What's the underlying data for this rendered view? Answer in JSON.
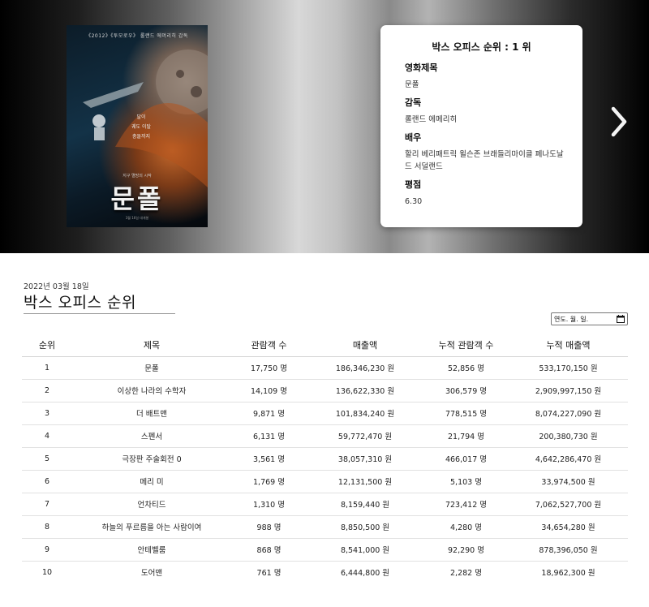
{
  "hero": {
    "poster": {
      "top_text": "《2012》《투모로우》 롤랜드 에머리히 감독",
      "tagline": [
        "달이",
        "궤도 이탈",
        "충돌까지"
      ],
      "subtitle": "지구 멸망의 시작",
      "title": "문폴",
      "credits": "3월 16일 대개봉"
    },
    "card": {
      "title": "박스 오피스 순위 : 1 위",
      "movie_title_label": "영화제목",
      "movie_title": "문폴",
      "director_label": "감독",
      "director": "롤랜드 에메리히",
      "actors_label": "배우",
      "actors": "할리 베리패트릭 윌슨존 브래들리마이클 페나도날드 서덜랜드",
      "rating_label": "평점",
      "rating": "6.30"
    },
    "next_icon": "chevron-right-icon"
  },
  "main": {
    "date": "2022년 03월 18일",
    "title": "박스 오피스 순위",
    "date_input": {
      "placeholder": "연도. 월. 일.",
      "icon": "calendar-icon"
    }
  },
  "table": {
    "headers": [
      "순위",
      "제목",
      "관람객 수",
      "매출액",
      "누적 관람객 수",
      "누적 매출액"
    ],
    "rows": [
      [
        "1",
        "문폴",
        "17,750 명",
        "186,346,230 원",
        "52,856 명",
        "533,170,150 원"
      ],
      [
        "2",
        "이상한 나라의 수학자",
        "14,109 명",
        "136,622,330 원",
        "306,579 명",
        "2,909,997,150 원"
      ],
      [
        "3",
        "더 배트맨",
        "9,871 명",
        "101,834,240 원",
        "778,515 명",
        "8,074,227,090 원"
      ],
      [
        "4",
        "스펜서",
        "6,131 명",
        "59,772,470 원",
        "21,794 명",
        "200,380,730 원"
      ],
      [
        "5",
        "극장판 주술회전 0",
        "3,561 명",
        "38,057,310 원",
        "466,017 명",
        "4,642,286,470 원"
      ],
      [
        "6",
        "메리 미",
        "1,769 명",
        "12,131,500 원",
        "5,103 명",
        "33,974,500 원"
      ],
      [
        "7",
        "언차티드",
        "1,310 명",
        "8,159,440 원",
        "723,412 명",
        "7,062,527,700 원"
      ],
      [
        "8",
        "하늘의 푸르름을 아는 사람이여",
        "988 명",
        "8,850,500 원",
        "4,280 명",
        "34,654,280 원"
      ],
      [
        "9",
        "안테벨룸",
        "868 명",
        "8,541,000 원",
        "92,290 명",
        "878,396,050 원"
      ],
      [
        "10",
        "도어맨",
        "761 명",
        "6,444,800 원",
        "2,282 명",
        "18,962,300 원"
      ]
    ]
  }
}
